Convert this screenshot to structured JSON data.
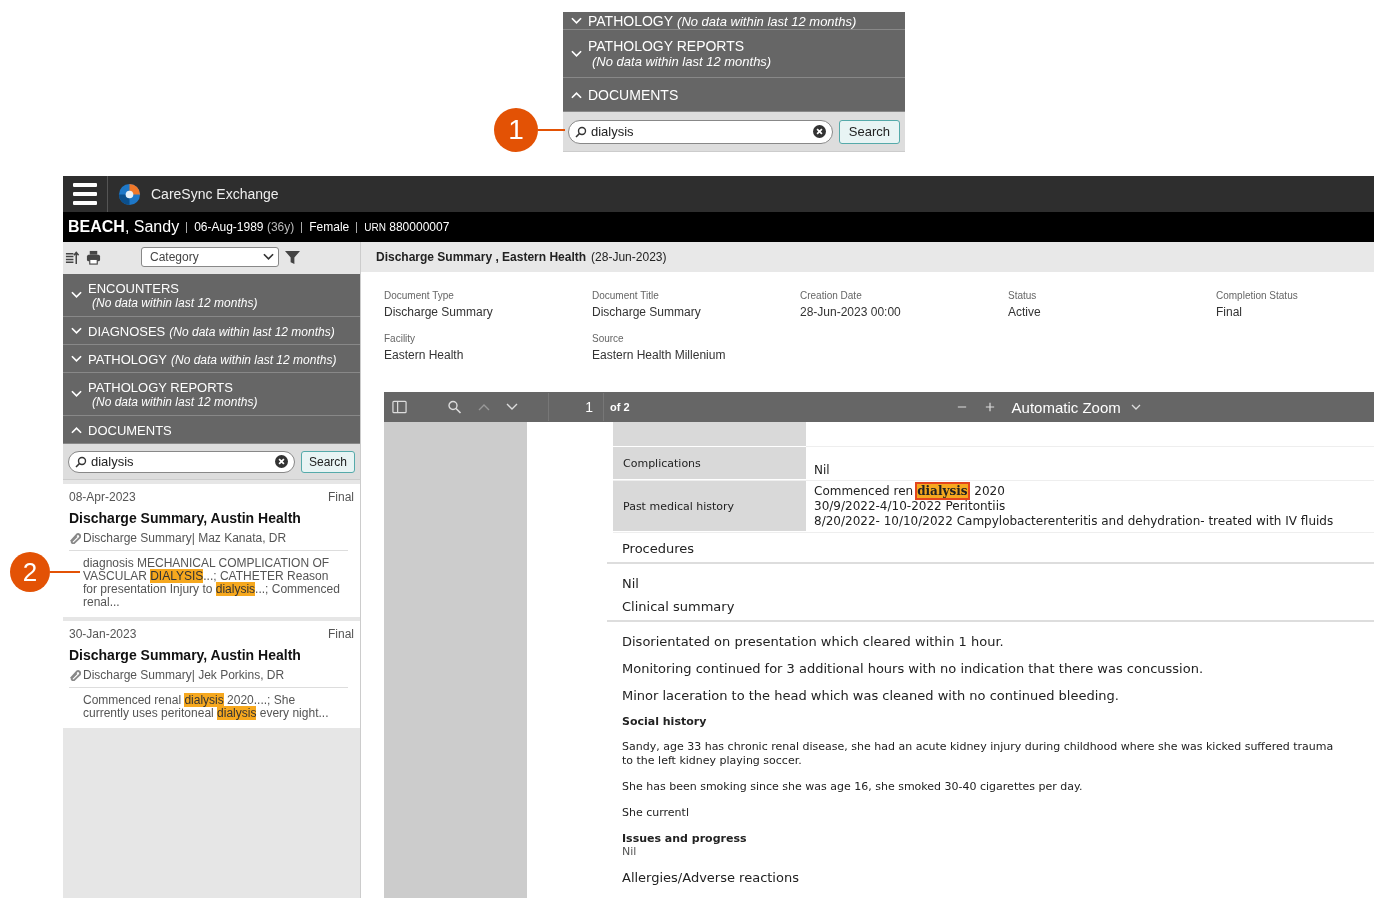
{
  "inset": {
    "callout": "1",
    "sections": [
      {
        "title": "PATHOLOGY",
        "note": "(No data within last 12 months)",
        "kind": "inline",
        "expanded": false
      },
      {
        "title": "PATHOLOGY REPORTS",
        "note": "(No data within last 12 months)",
        "kind": "stacked",
        "expanded": false
      },
      {
        "title": "DOCUMENTS",
        "kind": "inline",
        "expanded": true
      }
    ],
    "search": {
      "value": "dialysis"
    },
    "search_button": "Search"
  },
  "app": {
    "title": "CareSync Exchange"
  },
  "patient": {
    "name": "**BEACH**, Sandy",
    "dob": "06-Aug-1989",
    "age": "(36y)",
    "sex": "Female",
    "urn_label": "URN",
    "urn": "880000007"
  },
  "sidebar": {
    "category": {
      "placeholder": "Category"
    },
    "sections": [
      {
        "title": "ENCOUNTERS",
        "note": "(No data within last 12 months)",
        "kind": "stacked",
        "expanded": false
      },
      {
        "title": "DIAGNOSES",
        "note": "(No data within last 12 months)",
        "kind": "inline",
        "expanded": false
      },
      {
        "title": "PATHOLOGY",
        "note": "(No data within last 12 months)",
        "kind": "inline",
        "expanded": false
      },
      {
        "title": "PATHOLOGY REPORTS",
        "note": "(No data within last 12 months)",
        "kind": "stacked",
        "expanded": false
      },
      {
        "title": "DOCUMENTS",
        "kind": "inline",
        "expanded": true
      }
    ],
    "search": {
      "value": "dialysis"
    },
    "search_button": "Search",
    "results": [
      {
        "date": "08-Apr-2023",
        "status": "Final",
        "title": "Discharge Summary, Austin Health",
        "meta": "Discharge Summary| Maz Kanata, DR",
        "callout": "2",
        "snippet": [
          {
            "text": "diagnosis MECHANICAL COMPLICATION OF VASCULAR ",
            "highlight": false
          },
          {
            "text": "DIALYSIS",
            "highlight": true
          },
          {
            "text": "...; CATHETER Reason for presentation Injury to ",
            "highlight": false
          },
          {
            "text": "dialysis",
            "highlight": true
          },
          {
            "text": "...; Commenced renal...",
            "highlight": false
          }
        ]
      },
      {
        "date": "30-Jan-2023",
        "status": "Final",
        "title": "Discharge Summary, Austin Health",
        "meta": "Discharge Summary| Jek Porkins, DR",
        "snippet": [
          {
            "text": "Commenced renal ",
            "highlight": false
          },
          {
            "text": "dialysis",
            "highlight": true
          },
          {
            "text": " 2020....; She currently uses peritoneal ",
            "highlight": false
          },
          {
            "text": "dialysis",
            "highlight": true
          },
          {
            "text": " every night...",
            "highlight": false
          }
        ]
      }
    ]
  },
  "document": {
    "title": "Discharge Summary , Eastern Health",
    "date": "(28-Jun-2023)",
    "fields": [
      {
        "label": "Document Type",
        "value": "Discharge Summary"
      },
      {
        "label": "Document Title",
        "value": "Discharge Summary"
      },
      {
        "label": "Creation Date",
        "value": "28-Jun-2023 00:00"
      },
      {
        "label": "Status",
        "value": "Active"
      },
      {
        "label": "Completion Status",
        "value": "Final"
      },
      {
        "label": "Facility",
        "value": "Eastern Health"
      },
      {
        "label": "Source",
        "value": "Eastern Health Millenium"
      }
    ],
    "viewer": {
      "page": "1",
      "page_count": "of 2",
      "zoom": "Automatic Zoom"
    },
    "table": [
      {
        "label": "Complications",
        "lines": [
          [
            {
              "text": "Nil",
              "highlight": false,
              "framed": false
            }
          ]
        ]
      },
      {
        "label": "Past medical history",
        "lines": [
          [
            {
              "text": "Commenced ren",
              "highlight": false,
              "framed": false
            },
            {
              "text": "dialysis",
              "highlight": true,
              "framed": true
            },
            {
              "text": " 2020",
              "highlight": false,
              "framed": false
            }
          ],
          [
            {
              "text": "30/9/2022-4/10-2022 Peritontiis",
              "highlight": false,
              "framed": false
            }
          ],
          [
            {
              "text": "8/20/2022- 10/10/2022 Campylobacterenteritis and dehydration- treated with IV fluids",
              "highlight": false,
              "framed": false
            }
          ]
        ]
      }
    ],
    "blocks": [
      {
        "kind": "section",
        "text": "Procedures"
      },
      {
        "kind": "large",
        "text": "Nil"
      },
      {
        "kind": "section",
        "text": "Clinical summary"
      },
      {
        "kind": "large",
        "text": "Disorientated on presentation which cleared within 1 hour."
      },
      {
        "kind": "large",
        "text": "Monitoring continued for 3 additional hours with no indication that there was concussion."
      },
      {
        "kind": "large",
        "text": "Minor laceration to the head which was cleaned with no continued bleeding."
      },
      {
        "kind": "subheading",
        "text": "Social history"
      },
      {
        "kind": "small",
        "text": "Sandy, age 33  has chronic renal disease, she had an acute kidney injury during childhood where she was kicked suffered trauma to the left kidney playing soccer."
      },
      {
        "kind": "small",
        "text": "She has been smoking since she was age 16, she smoked 30-40 cigarettes per day."
      },
      {
        "kind": "small",
        "text": "She currentl"
      },
      {
        "kind": "subheading",
        "text": "Issues and progress"
      },
      {
        "kind": "note",
        "text": "Nil"
      },
      {
        "kind": "large",
        "text": "Allergies/Adverse reactions"
      }
    ]
  }
}
